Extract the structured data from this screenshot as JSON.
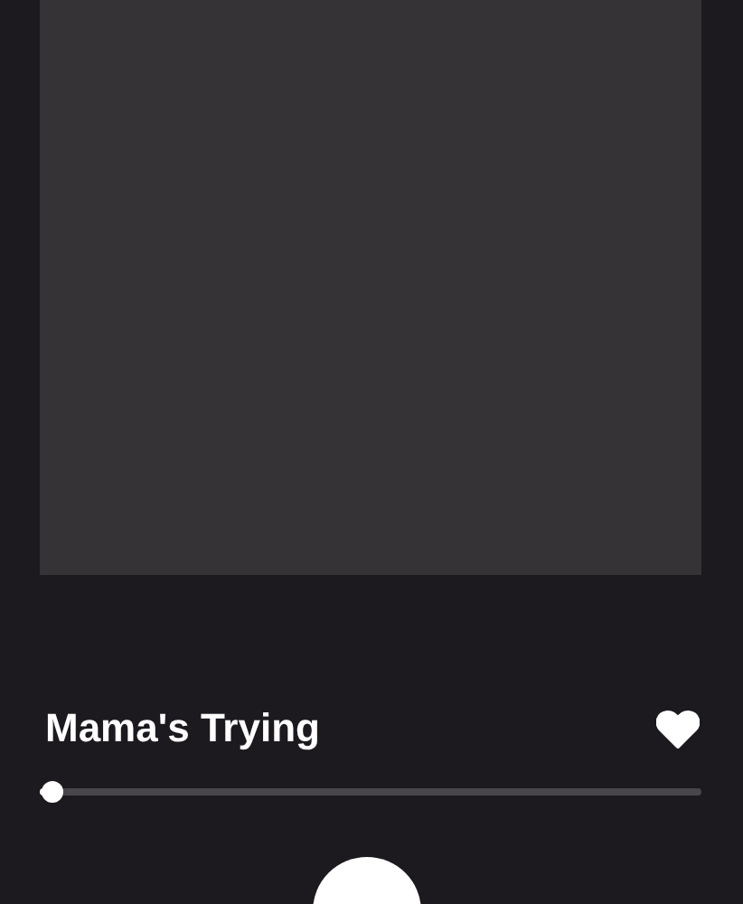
{
  "track": {
    "title": "Mama's Trying",
    "liked": true
  },
  "progress": {
    "level": 0.02
  }
}
